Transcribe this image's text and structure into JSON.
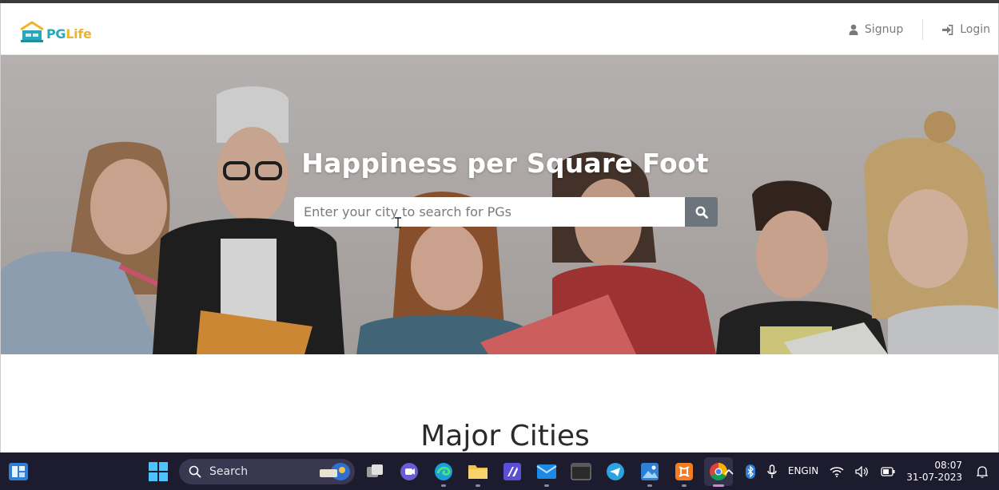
{
  "header": {
    "logo": {
      "pg": "PG",
      "life": "Life"
    },
    "nav": {
      "signup": "Signup",
      "login": "Login"
    }
  },
  "hero": {
    "title": "Happiness per Square Foot",
    "search": {
      "placeholder": "Enter your city to search for PGs",
      "value": ""
    }
  },
  "section": {
    "title": "Major Cities"
  },
  "taskbar": {
    "search_label": "Search",
    "apps": [
      "widgets-icon",
      "start-icon",
      "task-view-icon",
      "teams-icon",
      "edge-icon",
      "file-explorer-icon",
      "visual-studio-icon",
      "mail-icon",
      "terminal-icon",
      "telegram-icon",
      "photos-icon",
      "xampp-icon",
      "chrome-icon"
    ],
    "tray": {
      "language_line1": "ENG",
      "language_line2": "IN",
      "time": "08:07",
      "date": "31-07-2023"
    }
  },
  "colors": {
    "brand_teal": "#2aa7b8",
    "brand_yellow": "#f0b429",
    "search_button": "#6c757d",
    "taskbar": "#1d1b2e"
  }
}
